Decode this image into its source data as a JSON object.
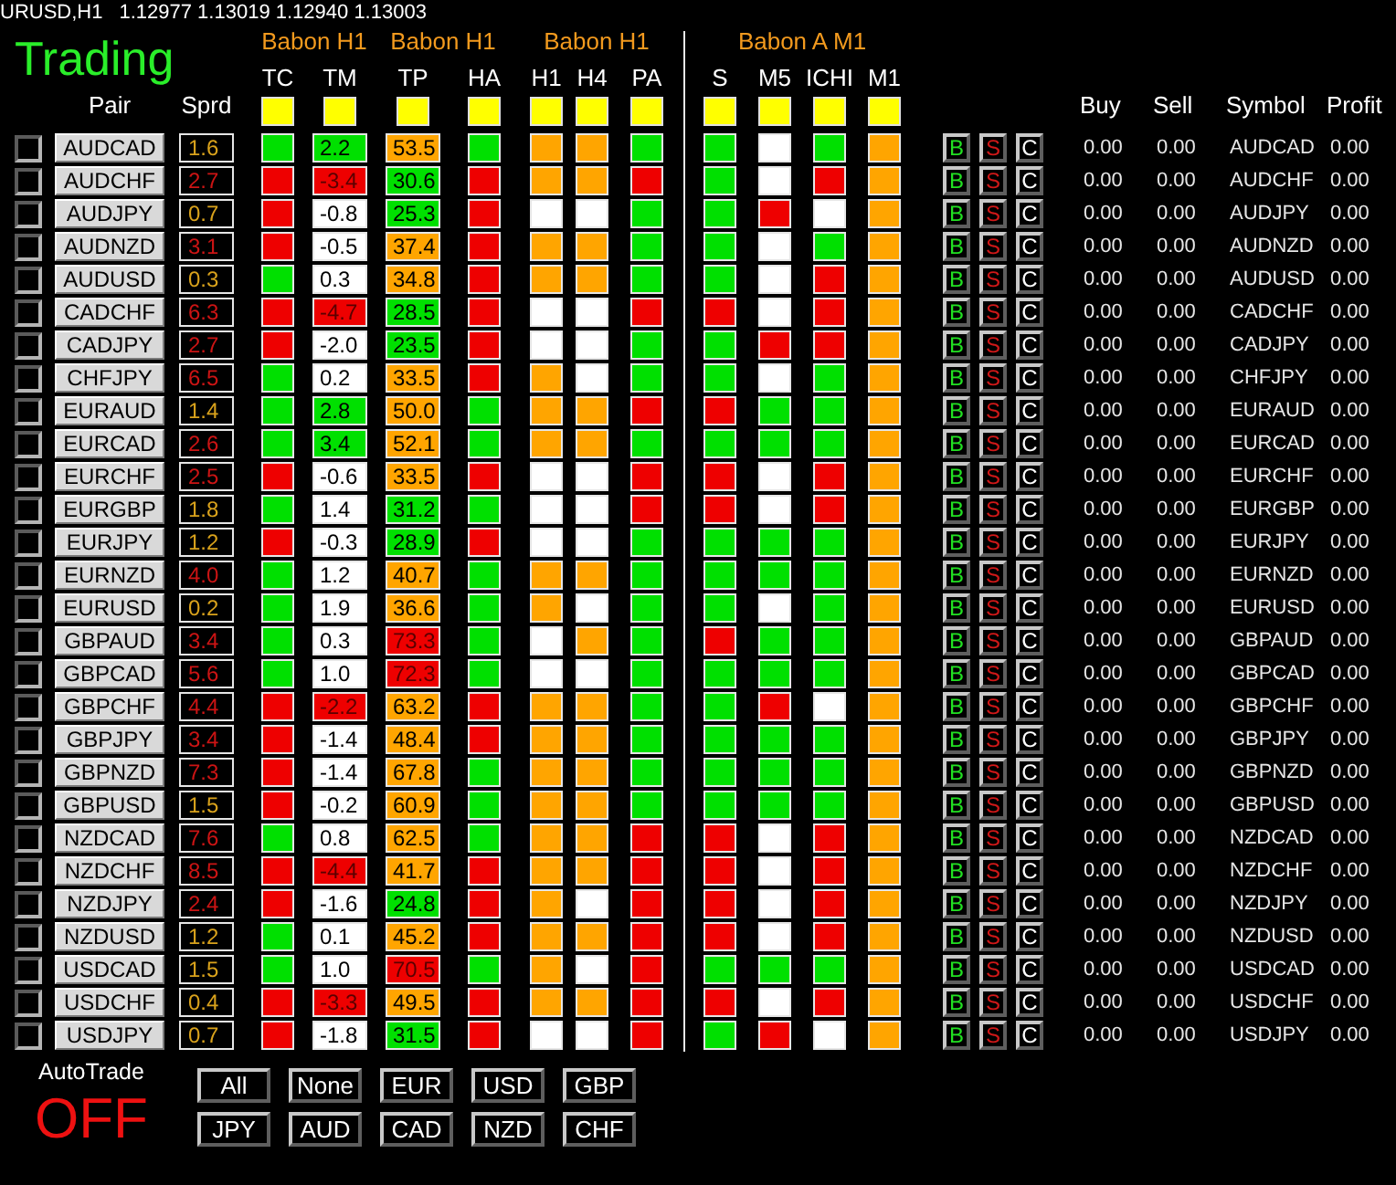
{
  "quote": {
    "symbol": "URUSD,H1",
    "prices": "1.12977 1.13019 1.12940 1.13003"
  },
  "header": {
    "title": "Trading",
    "groups": [
      {
        "label": "Babon H1",
        "columns": [
          "TC",
          "TM"
        ]
      },
      {
        "label": "Babon H1",
        "columns": [
          "TP",
          "HA"
        ]
      },
      {
        "label": "Babon H1",
        "columns": [
          "H1",
          "H4",
          "PA"
        ]
      },
      {
        "label": "Babon A M1",
        "columns": [
          "S",
          "M5",
          "ICHI",
          "M1"
        ]
      }
    ],
    "pair_columns": [
      "Pair",
      "Sprd"
    ],
    "trade_columns": [
      "Buy",
      "Sell",
      "Symbol",
      "Profit"
    ]
  },
  "rows": [
    {
      "checked": false,
      "pair": "AUDCAD",
      "spread": {
        "value": "1.6",
        "color": "#d9a21c"
      },
      "tc": {
        "color": "#00e000"
      },
      "tm": {
        "value": "2.2",
        "color": "#00e000"
      },
      "tp": {
        "value": "53.5",
        "color": "#ffa500"
      },
      "ha": {
        "color": "#00e000"
      },
      "h1": {
        "color": "#ffa500"
      },
      "h4": {
        "color": "#ffa500"
      },
      "pa": {
        "color": "#00e000"
      },
      "s": {
        "color": "#00e000"
      },
      "m5": {
        "color": "#ffffff"
      },
      "ichi": {
        "color": "#00e000"
      },
      "m1": {
        "color": "#ffa500"
      },
      "actions": [
        "B",
        "S",
        "C"
      ],
      "buy": "0.00",
      "sell": "0.00",
      "symbol": "AUDCAD",
      "profit": "0.00"
    },
    {
      "checked": false,
      "pair": "AUDCHF",
      "spread": {
        "value": "2.7",
        "color": "#cc1414"
      },
      "tc": {
        "color": "#ee0000"
      },
      "tm": {
        "value": "-3.4",
        "color": "#ee0000"
      },
      "tp": {
        "value": "30.6",
        "color": "#00e000"
      },
      "ha": {
        "color": "#ee0000"
      },
      "h1": {
        "color": "#ffa500"
      },
      "h4": {
        "color": "#ffa500"
      },
      "pa": {
        "color": "#ee0000"
      },
      "s": {
        "color": "#00e000"
      },
      "m5": {
        "color": "#ffffff"
      },
      "ichi": {
        "color": "#ee0000"
      },
      "m1": {
        "color": "#ffa500"
      },
      "actions": [
        "B",
        "S",
        "C"
      ],
      "buy": "0.00",
      "sell": "0.00",
      "symbol": "AUDCHF",
      "profit": "0.00"
    },
    {
      "checked": false,
      "pair": "AUDJPY",
      "spread": {
        "value": "0.7",
        "color": "#d9a21c"
      },
      "tc": {
        "color": "#ee0000"
      },
      "tm": {
        "value": "-0.8",
        "color": "#ffffff"
      },
      "tp": {
        "value": "25.3",
        "color": "#00e000"
      },
      "ha": {
        "color": "#ee0000"
      },
      "h1": {
        "color": "#ffffff"
      },
      "h4": {
        "color": "#ffffff"
      },
      "pa": {
        "color": "#00e000"
      },
      "s": {
        "color": "#00e000"
      },
      "m5": {
        "color": "#ee0000"
      },
      "ichi": {
        "color": "#ffffff"
      },
      "m1": {
        "color": "#ffa500"
      },
      "actions": [
        "B",
        "S",
        "C"
      ],
      "buy": "0.00",
      "sell": "0.00",
      "symbol": "AUDJPY",
      "profit": "0.00"
    },
    {
      "checked": false,
      "pair": "AUDNZD",
      "spread": {
        "value": "3.1",
        "color": "#cc1414"
      },
      "tc": {
        "color": "#ee0000"
      },
      "tm": {
        "value": "-0.5",
        "color": "#ffffff"
      },
      "tp": {
        "value": "37.4",
        "color": "#ffa500"
      },
      "ha": {
        "color": "#ee0000"
      },
      "h1": {
        "color": "#ffa500"
      },
      "h4": {
        "color": "#ffa500"
      },
      "pa": {
        "color": "#00e000"
      },
      "s": {
        "color": "#00e000"
      },
      "m5": {
        "color": "#ffffff"
      },
      "ichi": {
        "color": "#00e000"
      },
      "m1": {
        "color": "#ffa500"
      },
      "actions": [
        "B",
        "S",
        "C"
      ],
      "buy": "0.00",
      "sell": "0.00",
      "symbol": "AUDNZD",
      "profit": "0.00"
    },
    {
      "checked": false,
      "pair": "AUDUSD",
      "spread": {
        "value": "0.3",
        "color": "#d9a21c"
      },
      "tc": {
        "color": "#00e000"
      },
      "tm": {
        "value": "0.3",
        "color": "#ffffff"
      },
      "tp": {
        "value": "34.8",
        "color": "#ffa500"
      },
      "ha": {
        "color": "#ee0000"
      },
      "h1": {
        "color": "#ffa500"
      },
      "h4": {
        "color": "#ffa500"
      },
      "pa": {
        "color": "#00e000"
      },
      "s": {
        "color": "#00e000"
      },
      "m5": {
        "color": "#ffffff"
      },
      "ichi": {
        "color": "#ee0000"
      },
      "m1": {
        "color": "#ffa500"
      },
      "actions": [
        "B",
        "S",
        "C"
      ],
      "buy": "0.00",
      "sell": "0.00",
      "symbol": "AUDUSD",
      "profit": "0.00"
    },
    {
      "checked": false,
      "pair": "CADCHF",
      "spread": {
        "value": "6.3",
        "color": "#cc1414"
      },
      "tc": {
        "color": "#ee0000"
      },
      "tm": {
        "value": "-4.7",
        "color": "#ee0000"
      },
      "tp": {
        "value": "28.5",
        "color": "#00e000"
      },
      "ha": {
        "color": "#ee0000"
      },
      "h1": {
        "color": "#ffffff"
      },
      "h4": {
        "color": "#ffffff"
      },
      "pa": {
        "color": "#ee0000"
      },
      "s": {
        "color": "#ee0000"
      },
      "m5": {
        "color": "#ffffff"
      },
      "ichi": {
        "color": "#ee0000"
      },
      "m1": {
        "color": "#ffa500"
      },
      "actions": [
        "B",
        "S",
        "C"
      ],
      "buy": "0.00",
      "sell": "0.00",
      "symbol": "CADCHF",
      "profit": "0.00"
    },
    {
      "checked": false,
      "pair": "CADJPY",
      "spread": {
        "value": "2.7",
        "color": "#cc1414"
      },
      "tc": {
        "color": "#ee0000"
      },
      "tm": {
        "value": "-2.0",
        "color": "#ffffff"
      },
      "tp": {
        "value": "23.5",
        "color": "#00e000"
      },
      "ha": {
        "color": "#ee0000"
      },
      "h1": {
        "color": "#ffffff"
      },
      "h4": {
        "color": "#ffffff"
      },
      "pa": {
        "color": "#00e000"
      },
      "s": {
        "color": "#00e000"
      },
      "m5": {
        "color": "#ee0000"
      },
      "ichi": {
        "color": "#ee0000"
      },
      "m1": {
        "color": "#ffa500"
      },
      "actions": [
        "B",
        "S",
        "C"
      ],
      "buy": "0.00",
      "sell": "0.00",
      "symbol": "CADJPY",
      "profit": "0.00"
    },
    {
      "checked": false,
      "pair": "CHFJPY",
      "spread": {
        "value": "6.5",
        "color": "#cc1414"
      },
      "tc": {
        "color": "#00e000"
      },
      "tm": {
        "value": "0.2",
        "color": "#ffffff"
      },
      "tp": {
        "value": "33.5",
        "color": "#ffa500"
      },
      "ha": {
        "color": "#ee0000"
      },
      "h1": {
        "color": "#ffa500"
      },
      "h4": {
        "color": "#ffffff"
      },
      "pa": {
        "color": "#00e000"
      },
      "s": {
        "color": "#00e000"
      },
      "m5": {
        "color": "#ffffff"
      },
      "ichi": {
        "color": "#00e000"
      },
      "m1": {
        "color": "#ffa500"
      },
      "actions": [
        "B",
        "S",
        "C"
      ],
      "buy": "0.00",
      "sell": "0.00",
      "symbol": "CHFJPY",
      "profit": "0.00"
    },
    {
      "checked": false,
      "pair": "EURAUD",
      "spread": {
        "value": "1.4",
        "color": "#d9a21c"
      },
      "tc": {
        "color": "#00e000"
      },
      "tm": {
        "value": "2.8",
        "color": "#00e000"
      },
      "tp": {
        "value": "50.0",
        "color": "#ffa500"
      },
      "ha": {
        "color": "#00e000"
      },
      "h1": {
        "color": "#ffa500"
      },
      "h4": {
        "color": "#ffa500"
      },
      "pa": {
        "color": "#ee0000"
      },
      "s": {
        "color": "#ee0000"
      },
      "m5": {
        "color": "#00e000"
      },
      "ichi": {
        "color": "#00e000"
      },
      "m1": {
        "color": "#ffa500"
      },
      "actions": [
        "B",
        "S",
        "C"
      ],
      "buy": "0.00",
      "sell": "0.00",
      "symbol": "EURAUD",
      "profit": "0.00"
    },
    {
      "checked": false,
      "pair": "EURCAD",
      "spread": {
        "value": "2.6",
        "color": "#cc1414"
      },
      "tc": {
        "color": "#00e000"
      },
      "tm": {
        "value": "3.4",
        "color": "#00e000"
      },
      "tp": {
        "value": "52.1",
        "color": "#ffa500"
      },
      "ha": {
        "color": "#00e000"
      },
      "h1": {
        "color": "#ffa500"
      },
      "h4": {
        "color": "#ffa500"
      },
      "pa": {
        "color": "#00e000"
      },
      "s": {
        "color": "#00e000"
      },
      "m5": {
        "color": "#00e000"
      },
      "ichi": {
        "color": "#00e000"
      },
      "m1": {
        "color": "#ffa500"
      },
      "actions": [
        "B",
        "S",
        "C"
      ],
      "buy": "0.00",
      "sell": "0.00",
      "symbol": "EURCAD",
      "profit": "0.00"
    },
    {
      "checked": false,
      "pair": "EURCHF",
      "spread": {
        "value": "2.5",
        "color": "#cc1414"
      },
      "tc": {
        "color": "#ee0000"
      },
      "tm": {
        "value": "-0.6",
        "color": "#ffffff"
      },
      "tp": {
        "value": "33.5",
        "color": "#ffa500"
      },
      "ha": {
        "color": "#ee0000"
      },
      "h1": {
        "color": "#ffffff"
      },
      "h4": {
        "color": "#ffffff"
      },
      "pa": {
        "color": "#ee0000"
      },
      "s": {
        "color": "#ee0000"
      },
      "m5": {
        "color": "#ffffff"
      },
      "ichi": {
        "color": "#ee0000"
      },
      "m1": {
        "color": "#ffa500"
      },
      "actions": [
        "B",
        "S",
        "C"
      ],
      "buy": "0.00",
      "sell": "0.00",
      "symbol": "EURCHF",
      "profit": "0.00"
    },
    {
      "checked": false,
      "pair": "EURGBP",
      "spread": {
        "value": "1.8",
        "color": "#d9a21c"
      },
      "tc": {
        "color": "#00e000"
      },
      "tm": {
        "value": "1.4",
        "color": "#ffffff"
      },
      "tp": {
        "value": "31.2",
        "color": "#00e000"
      },
      "ha": {
        "color": "#00e000"
      },
      "h1": {
        "color": "#ffffff"
      },
      "h4": {
        "color": "#ffffff"
      },
      "pa": {
        "color": "#ee0000"
      },
      "s": {
        "color": "#ee0000"
      },
      "m5": {
        "color": "#ffffff"
      },
      "ichi": {
        "color": "#ee0000"
      },
      "m1": {
        "color": "#ffa500"
      },
      "actions": [
        "B",
        "S",
        "C"
      ],
      "buy": "0.00",
      "sell": "0.00",
      "symbol": "EURGBP",
      "profit": "0.00"
    },
    {
      "checked": false,
      "pair": "EURJPY",
      "spread": {
        "value": "1.2",
        "color": "#d9a21c"
      },
      "tc": {
        "color": "#ee0000"
      },
      "tm": {
        "value": "-0.3",
        "color": "#ffffff"
      },
      "tp": {
        "value": "28.9",
        "color": "#00e000"
      },
      "ha": {
        "color": "#ee0000"
      },
      "h1": {
        "color": "#ffffff"
      },
      "h4": {
        "color": "#ffffff"
      },
      "pa": {
        "color": "#00e000"
      },
      "s": {
        "color": "#00e000"
      },
      "m5": {
        "color": "#00e000"
      },
      "ichi": {
        "color": "#00e000"
      },
      "m1": {
        "color": "#ffa500"
      },
      "actions": [
        "B",
        "S",
        "C"
      ],
      "buy": "0.00",
      "sell": "0.00",
      "symbol": "EURJPY",
      "profit": "0.00"
    },
    {
      "checked": false,
      "pair": "EURNZD",
      "spread": {
        "value": "4.0",
        "color": "#cc1414"
      },
      "tc": {
        "color": "#00e000"
      },
      "tm": {
        "value": "1.2",
        "color": "#ffffff"
      },
      "tp": {
        "value": "40.7",
        "color": "#ffa500"
      },
      "ha": {
        "color": "#00e000"
      },
      "h1": {
        "color": "#ffa500"
      },
      "h4": {
        "color": "#ffa500"
      },
      "pa": {
        "color": "#00e000"
      },
      "s": {
        "color": "#00e000"
      },
      "m5": {
        "color": "#00e000"
      },
      "ichi": {
        "color": "#00e000"
      },
      "m1": {
        "color": "#ffa500"
      },
      "actions": [
        "B",
        "S",
        "C"
      ],
      "buy": "0.00",
      "sell": "0.00",
      "symbol": "EURNZD",
      "profit": "0.00"
    },
    {
      "checked": false,
      "pair": "EURUSD",
      "spread": {
        "value": "0.2",
        "color": "#d9a21c"
      },
      "tc": {
        "color": "#00e000"
      },
      "tm": {
        "value": "1.9",
        "color": "#ffffff"
      },
      "tp": {
        "value": "36.6",
        "color": "#ffa500"
      },
      "ha": {
        "color": "#00e000"
      },
      "h1": {
        "color": "#ffa500"
      },
      "h4": {
        "color": "#ffffff"
      },
      "pa": {
        "color": "#00e000"
      },
      "s": {
        "color": "#00e000"
      },
      "m5": {
        "color": "#ffffff"
      },
      "ichi": {
        "color": "#00e000"
      },
      "m1": {
        "color": "#ffa500"
      },
      "actions": [
        "B",
        "S",
        "C"
      ],
      "buy": "0.00",
      "sell": "0.00",
      "symbol": "EURUSD",
      "profit": "0.00"
    },
    {
      "checked": false,
      "pair": "GBPAUD",
      "spread": {
        "value": "3.4",
        "color": "#cc1414"
      },
      "tc": {
        "color": "#00e000"
      },
      "tm": {
        "value": "0.3",
        "color": "#ffffff"
      },
      "tp": {
        "value": "73.3",
        "color": "#ee0000"
      },
      "ha": {
        "color": "#00e000"
      },
      "h1": {
        "color": "#ffffff"
      },
      "h4": {
        "color": "#ffa500"
      },
      "pa": {
        "color": "#00e000"
      },
      "s": {
        "color": "#ee0000"
      },
      "m5": {
        "color": "#00e000"
      },
      "ichi": {
        "color": "#00e000"
      },
      "m1": {
        "color": "#ffa500"
      },
      "actions": [
        "B",
        "S",
        "C"
      ],
      "buy": "0.00",
      "sell": "0.00",
      "symbol": "GBPAUD",
      "profit": "0.00"
    },
    {
      "checked": false,
      "pair": "GBPCAD",
      "spread": {
        "value": "5.6",
        "color": "#cc1414"
      },
      "tc": {
        "color": "#00e000"
      },
      "tm": {
        "value": "1.0",
        "color": "#ffffff"
      },
      "tp": {
        "value": "72.3",
        "color": "#ee0000"
      },
      "ha": {
        "color": "#00e000"
      },
      "h1": {
        "color": "#ffffff"
      },
      "h4": {
        "color": "#ffffff"
      },
      "pa": {
        "color": "#00e000"
      },
      "s": {
        "color": "#00e000"
      },
      "m5": {
        "color": "#00e000"
      },
      "ichi": {
        "color": "#00e000"
      },
      "m1": {
        "color": "#ffa500"
      },
      "actions": [
        "B",
        "S",
        "C"
      ],
      "buy": "0.00",
      "sell": "0.00",
      "symbol": "GBPCAD",
      "profit": "0.00"
    },
    {
      "checked": false,
      "pair": "GBPCHF",
      "spread": {
        "value": "4.4",
        "color": "#cc1414"
      },
      "tc": {
        "color": "#ee0000"
      },
      "tm": {
        "value": "-2.2",
        "color": "#ee0000"
      },
      "tp": {
        "value": "63.2",
        "color": "#ffa500"
      },
      "ha": {
        "color": "#ee0000"
      },
      "h1": {
        "color": "#ffa500"
      },
      "h4": {
        "color": "#ffa500"
      },
      "pa": {
        "color": "#00e000"
      },
      "s": {
        "color": "#00e000"
      },
      "m5": {
        "color": "#ee0000"
      },
      "ichi": {
        "color": "#ffffff"
      },
      "m1": {
        "color": "#ffa500"
      },
      "actions": [
        "B",
        "S",
        "C"
      ],
      "buy": "0.00",
      "sell": "0.00",
      "symbol": "GBPCHF",
      "profit": "0.00"
    },
    {
      "checked": false,
      "pair": "GBPJPY",
      "spread": {
        "value": "3.4",
        "color": "#cc1414"
      },
      "tc": {
        "color": "#ee0000"
      },
      "tm": {
        "value": "-1.4",
        "color": "#ffffff"
      },
      "tp": {
        "value": "48.4",
        "color": "#ffa500"
      },
      "ha": {
        "color": "#ee0000"
      },
      "h1": {
        "color": "#ffa500"
      },
      "h4": {
        "color": "#ffa500"
      },
      "pa": {
        "color": "#00e000"
      },
      "s": {
        "color": "#00e000"
      },
      "m5": {
        "color": "#00e000"
      },
      "ichi": {
        "color": "#00e000"
      },
      "m1": {
        "color": "#ffa500"
      },
      "actions": [
        "B",
        "S",
        "C"
      ],
      "buy": "0.00",
      "sell": "0.00",
      "symbol": "GBPJPY",
      "profit": "0.00"
    },
    {
      "checked": false,
      "pair": "GBPNZD",
      "spread": {
        "value": "7.3",
        "color": "#cc1414"
      },
      "tc": {
        "color": "#ee0000"
      },
      "tm": {
        "value": "-1.4",
        "color": "#ffffff"
      },
      "tp": {
        "value": "67.8",
        "color": "#ffa500"
      },
      "ha": {
        "color": "#00e000"
      },
      "h1": {
        "color": "#ffa500"
      },
      "h4": {
        "color": "#ffa500"
      },
      "pa": {
        "color": "#00e000"
      },
      "s": {
        "color": "#00e000"
      },
      "m5": {
        "color": "#00e000"
      },
      "ichi": {
        "color": "#00e000"
      },
      "m1": {
        "color": "#ffa500"
      },
      "actions": [
        "B",
        "S",
        "C"
      ],
      "buy": "0.00",
      "sell": "0.00",
      "symbol": "GBPNZD",
      "profit": "0.00"
    },
    {
      "checked": false,
      "pair": "GBPUSD",
      "spread": {
        "value": "1.5",
        "color": "#d9a21c"
      },
      "tc": {
        "color": "#ee0000"
      },
      "tm": {
        "value": "-0.2",
        "color": "#ffffff"
      },
      "tp": {
        "value": "60.9",
        "color": "#ffa500"
      },
      "ha": {
        "color": "#00e000"
      },
      "h1": {
        "color": "#ffa500"
      },
      "h4": {
        "color": "#ffa500"
      },
      "pa": {
        "color": "#00e000"
      },
      "s": {
        "color": "#00e000"
      },
      "m5": {
        "color": "#00e000"
      },
      "ichi": {
        "color": "#00e000"
      },
      "m1": {
        "color": "#ffa500"
      },
      "actions": [
        "B",
        "S",
        "C"
      ],
      "buy": "0.00",
      "sell": "0.00",
      "symbol": "GBPUSD",
      "profit": "0.00"
    },
    {
      "checked": false,
      "pair": "NZDCAD",
      "spread": {
        "value": "7.6",
        "color": "#cc1414"
      },
      "tc": {
        "color": "#00e000"
      },
      "tm": {
        "value": "0.8",
        "color": "#ffffff"
      },
      "tp": {
        "value": "62.5",
        "color": "#ffa500"
      },
      "ha": {
        "color": "#00e000"
      },
      "h1": {
        "color": "#ffa500"
      },
      "h4": {
        "color": "#ffa500"
      },
      "pa": {
        "color": "#ee0000"
      },
      "s": {
        "color": "#ee0000"
      },
      "m5": {
        "color": "#ffffff"
      },
      "ichi": {
        "color": "#ee0000"
      },
      "m1": {
        "color": "#ffa500"
      },
      "actions": [
        "B",
        "S",
        "C"
      ],
      "buy": "0.00",
      "sell": "0.00",
      "symbol": "NZDCAD",
      "profit": "0.00"
    },
    {
      "checked": false,
      "pair": "NZDCHF",
      "spread": {
        "value": "8.5",
        "color": "#cc1414"
      },
      "tc": {
        "color": "#ee0000"
      },
      "tm": {
        "value": "-4.4",
        "color": "#ee0000"
      },
      "tp": {
        "value": "41.7",
        "color": "#ffa500"
      },
      "ha": {
        "color": "#ee0000"
      },
      "h1": {
        "color": "#ffa500"
      },
      "h4": {
        "color": "#ffa500"
      },
      "pa": {
        "color": "#ee0000"
      },
      "s": {
        "color": "#ee0000"
      },
      "m5": {
        "color": "#ffffff"
      },
      "ichi": {
        "color": "#ee0000"
      },
      "m1": {
        "color": "#ffa500"
      },
      "actions": [
        "B",
        "S",
        "C"
      ],
      "buy": "0.00",
      "sell": "0.00",
      "symbol": "NZDCHF",
      "profit": "0.00"
    },
    {
      "checked": false,
      "pair": "NZDJPY",
      "spread": {
        "value": "2.4",
        "color": "#cc1414"
      },
      "tc": {
        "color": "#ee0000"
      },
      "tm": {
        "value": "-1.6",
        "color": "#ffffff"
      },
      "tp": {
        "value": "24.8",
        "color": "#00e000"
      },
      "ha": {
        "color": "#ee0000"
      },
      "h1": {
        "color": "#ffa500"
      },
      "h4": {
        "color": "#ffffff"
      },
      "pa": {
        "color": "#ee0000"
      },
      "s": {
        "color": "#ee0000"
      },
      "m5": {
        "color": "#ffffff"
      },
      "ichi": {
        "color": "#ee0000"
      },
      "m1": {
        "color": "#ffa500"
      },
      "actions": [
        "B",
        "S",
        "C"
      ],
      "buy": "0.00",
      "sell": "0.00",
      "symbol": "NZDJPY",
      "profit": "0.00"
    },
    {
      "checked": false,
      "pair": "NZDUSD",
      "spread": {
        "value": "1.2",
        "color": "#d9a21c"
      },
      "tc": {
        "color": "#00e000"
      },
      "tm": {
        "value": "0.1",
        "color": "#ffffff"
      },
      "tp": {
        "value": "45.2",
        "color": "#ffa500"
      },
      "ha": {
        "color": "#ee0000"
      },
      "h1": {
        "color": "#ffa500"
      },
      "h4": {
        "color": "#ffa500"
      },
      "pa": {
        "color": "#ee0000"
      },
      "s": {
        "color": "#ee0000"
      },
      "m5": {
        "color": "#ffffff"
      },
      "ichi": {
        "color": "#ee0000"
      },
      "m1": {
        "color": "#ffa500"
      },
      "actions": [
        "B",
        "S",
        "C"
      ],
      "buy": "0.00",
      "sell": "0.00",
      "symbol": "NZDUSD",
      "profit": "0.00"
    },
    {
      "checked": false,
      "pair": "USDCAD",
      "spread": {
        "value": "1.5",
        "color": "#d9a21c"
      },
      "tc": {
        "color": "#00e000"
      },
      "tm": {
        "value": "1.0",
        "color": "#ffffff"
      },
      "tp": {
        "value": "70.5",
        "color": "#ee0000"
      },
      "ha": {
        "color": "#00e000"
      },
      "h1": {
        "color": "#ffa500"
      },
      "h4": {
        "color": "#ffffff"
      },
      "pa": {
        "color": "#ee0000"
      },
      "s": {
        "color": "#00e000"
      },
      "m5": {
        "color": "#00e000"
      },
      "ichi": {
        "color": "#00e000"
      },
      "m1": {
        "color": "#ffa500"
      },
      "actions": [
        "B",
        "S",
        "C"
      ],
      "buy": "0.00",
      "sell": "0.00",
      "symbol": "USDCAD",
      "profit": "0.00"
    },
    {
      "checked": false,
      "pair": "USDCHF",
      "spread": {
        "value": "0.4",
        "color": "#d9a21c"
      },
      "tc": {
        "color": "#ee0000"
      },
      "tm": {
        "value": "-3.3",
        "color": "#ee0000"
      },
      "tp": {
        "value": "49.5",
        "color": "#ffa500"
      },
      "ha": {
        "color": "#ee0000"
      },
      "h1": {
        "color": "#ffa500"
      },
      "h4": {
        "color": "#ffa500"
      },
      "pa": {
        "color": "#ee0000"
      },
      "s": {
        "color": "#ee0000"
      },
      "m5": {
        "color": "#ffffff"
      },
      "ichi": {
        "color": "#ee0000"
      },
      "m1": {
        "color": "#ffa500"
      },
      "actions": [
        "B",
        "S",
        "C"
      ],
      "buy": "0.00",
      "sell": "0.00",
      "symbol": "USDCHF",
      "profit": "0.00"
    },
    {
      "checked": false,
      "pair": "USDJPY",
      "spread": {
        "value": "0.7",
        "color": "#d9a21c"
      },
      "tc": {
        "color": "#ee0000"
      },
      "tm": {
        "value": "-1.8",
        "color": "#ffffff"
      },
      "tp": {
        "value": "31.5",
        "color": "#00e000"
      },
      "ha": {
        "color": "#ee0000"
      },
      "h1": {
        "color": "#ffffff"
      },
      "h4": {
        "color": "#ffffff"
      },
      "pa": {
        "color": "#ee0000"
      },
      "s": {
        "color": "#00e000"
      },
      "m5": {
        "color": "#ee0000"
      },
      "ichi": {
        "color": "#ffffff"
      },
      "m1": {
        "color": "#ffa500"
      },
      "actions": [
        "B",
        "S",
        "C"
      ],
      "buy": "0.00",
      "sell": "0.00",
      "symbol": "USDJPY",
      "profit": "0.00"
    }
  ],
  "autotrade": {
    "label": "AutoTrade",
    "status": "OFF",
    "on": false
  },
  "filter_buttons": [
    "All",
    "None",
    "EUR",
    "USD",
    "GBP",
    "JPY",
    "AUD",
    "CAD",
    "NZD",
    "CHF"
  ]
}
